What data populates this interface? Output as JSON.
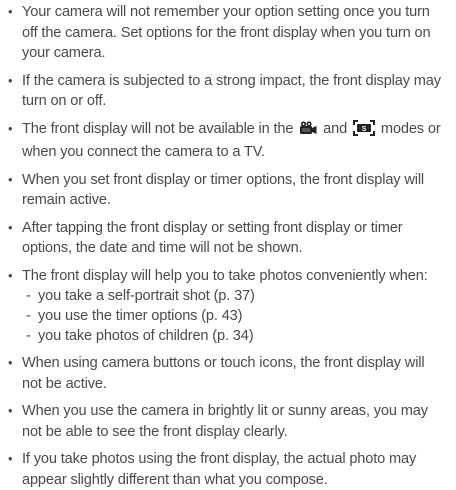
{
  "notes": [
    "Your camera will not remember your option setting once you turn off the camera. Set options for the front display when you turn on your camera.",
    "If the camera is subjected to a strong impact, the front display may turn on or off.",
    {
      "before": "The front display will not be available in the",
      "and": "and",
      "after": "modes or when you connect the camera to a TV.",
      "icons": [
        "movie-mode-icon",
        "smart-scene-detection-mode-icon"
      ]
    },
    "When you set front display or timer options, the front display will remain active.",
    "After tapping the front display or setting front display or timer options, the date and time will not be shown.",
    {
      "lead": "The front display will help you to take photos conveniently when:",
      "sub": [
        "you take a self-portrait shot (p. 37)",
        "you use the timer options (p. 43)",
        "you take photos of children (p. 34)"
      ]
    },
    "When using camera buttons or touch icons, the front display will not be active.",
    "When you use the camera in brightly lit or sunny areas, you may not be able to see the front display clearly.",
    "If you take photos using the front display, the actual photo may appear slightly different than what you compose."
  ],
  "bullet_char": "•",
  "dash_char": "-",
  "colors": {
    "text": "#4a4a4a",
    "icon": "#222222"
  }
}
